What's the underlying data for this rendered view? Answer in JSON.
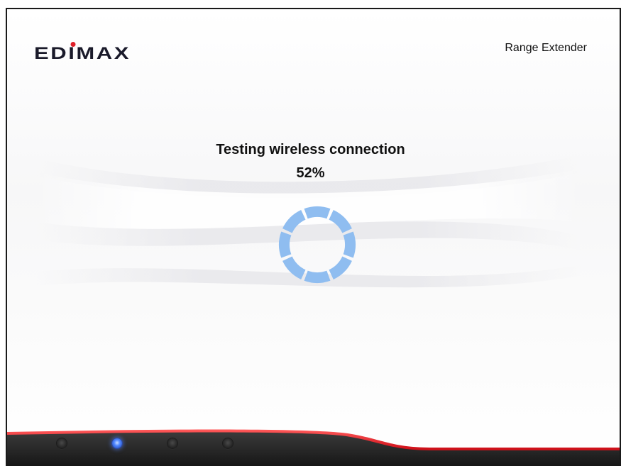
{
  "header": {
    "brand": "EDIMAX",
    "product": "Range Extender"
  },
  "status": {
    "message": "Testing wireless connection",
    "progress_percent": 52,
    "progress_label": "52%"
  },
  "spinner": {
    "icon": "loading-spinner-icon",
    "color": "#8fbdf0",
    "segments": 8
  },
  "footer": {
    "leds": [
      {
        "name": "led-1",
        "state": "off"
      },
      {
        "name": "led-2",
        "state": "on",
        "color": "#4f86ff"
      },
      {
        "name": "led-3",
        "state": "off"
      },
      {
        "name": "led-4",
        "state": "off"
      }
    ]
  },
  "colors": {
    "accent_red": "#d0121b",
    "logo_dot": "#e0202a",
    "text": "#111111"
  }
}
